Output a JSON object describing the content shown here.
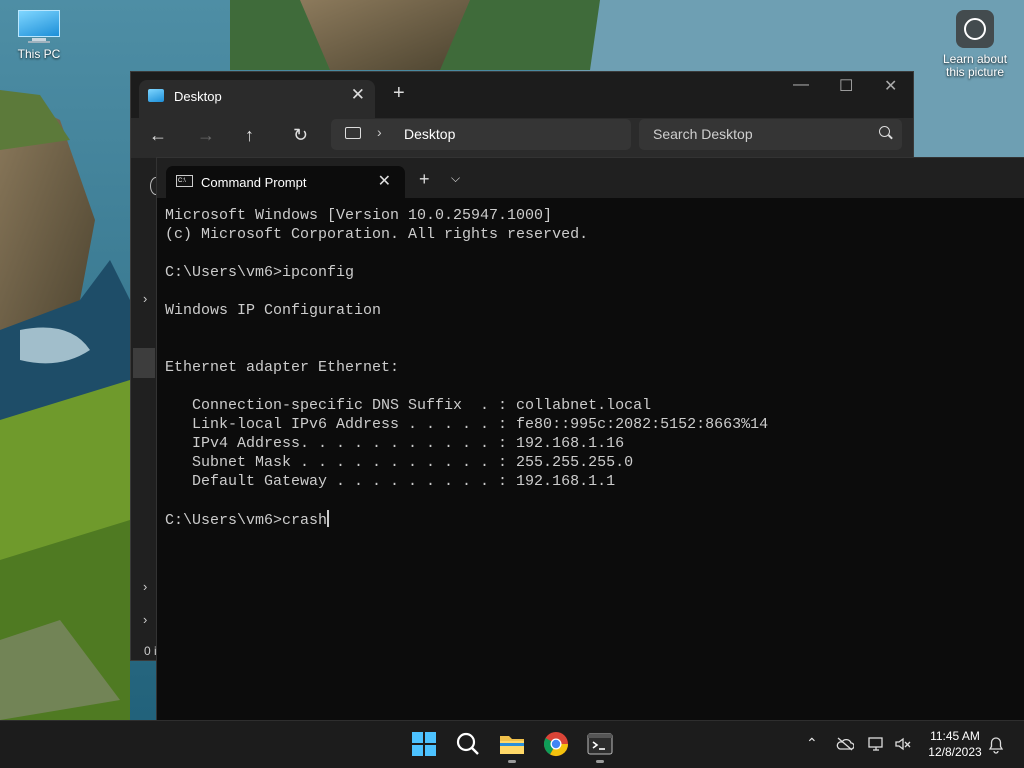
{
  "desktop": {
    "icons": [
      {
        "label": "This PC"
      },
      {
        "label": "Learn about this picture"
      }
    ]
  },
  "explorer": {
    "tab_title": "Desktop",
    "address": "Desktop",
    "search_placeholder": "Search Desktop",
    "status_text": "0 i"
  },
  "terminal": {
    "tab_title": "Command Prompt",
    "lines": [
      "Microsoft Windows [Version 10.0.25947.1000]",
      "(c) Microsoft Corporation. All rights reserved.",
      "",
      "C:\\Users\\vm6>ipconfig",
      "",
      "Windows IP Configuration",
      "",
      "",
      "Ethernet adapter Ethernet:",
      "",
      "   Connection-specific DNS Suffix  . : collabnet.local",
      "   Link-local IPv6 Address . . . . . : fe80::995c:2082:5152:8663%14",
      "   IPv4 Address. . . . . . . . . . . : 192.168.1.16",
      "   Subnet Mask . . . . . . . . . . . : 255.255.255.0",
      "   Default Gateway . . . . . . . . . : 192.168.1.1",
      ""
    ],
    "prompt": "C:\\Users\\vm6>",
    "input": "crash"
  },
  "taskbar": {
    "apps": [
      "start-icon",
      "search-icon",
      "file-explorer-icon",
      "chrome-icon",
      "terminal-icon"
    ],
    "clock_time": "11:45 AM",
    "clock_date": "12/8/2023"
  },
  "colors": {
    "accent": "#4cc2ff",
    "terminal_bg": "#0c0c0c",
    "terminal_fg": "#cccccc"
  }
}
